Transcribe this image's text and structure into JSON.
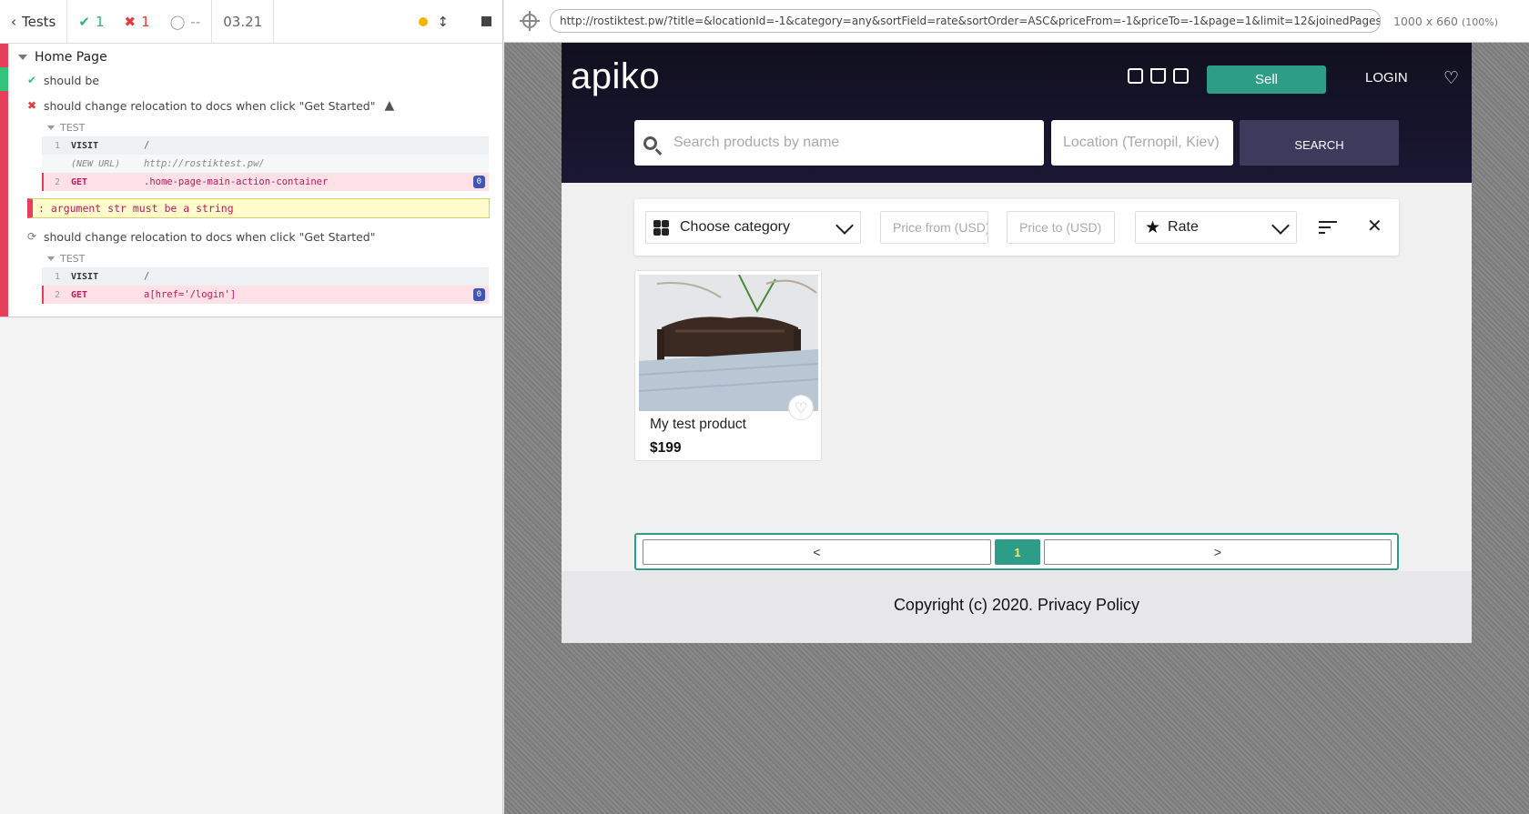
{
  "reporter": {
    "header": {
      "tests_label": "Tests",
      "passed": "1",
      "failed": "1",
      "pending": "--",
      "duration": "03.21"
    },
    "suite": {
      "title": "Home Page",
      "tests": [
        {
          "title": "should be",
          "state": "passed"
        },
        {
          "title": "should change relocation to docs when click \"Get Started\"",
          "state": "failed",
          "section_label": "TEST",
          "commands": [
            {
              "num": "1",
              "name": "VISIT",
              "message": "/"
            },
            {
              "num": "",
              "name": "(NEW URL)",
              "message": "http://rostiktest.pw/"
            },
            {
              "num": "2",
              "name": "GET",
              "message": ".home-page-main-action-container",
              "badge": "0"
            }
          ],
          "error": ": argument str must be a string"
        },
        {
          "title": "should change relocation to docs when click \"Get Started\"",
          "state": "running",
          "section_label": "TEST",
          "commands": [
            {
              "num": "1",
              "name": "VISIT",
              "message": "/"
            },
            {
              "num": "2",
              "name": "GET",
              "message": "a[href='/login']",
              "badge": "0"
            }
          ]
        }
      ]
    }
  },
  "runner": {
    "url": "http://rostiktest.pw/?title=&locationId=-1&category=any&sortField=rate&sortOrder=ASC&priceFrom=-1&priceTo=-1&page=1&limit=12&joinedPages",
    "viewport": "1000 x 660",
    "zoom": "(100%)"
  },
  "app": {
    "logo": "apiko",
    "sell_label": "Sell",
    "login_label": "LOGIN",
    "search": {
      "placeholder": "Search products by name",
      "location_placeholder": "Location (Ternopil, Kiev)",
      "button_label": "SEARCH"
    },
    "filters": {
      "category": "Choose category",
      "price_from_placeholder": "Price from (USD)",
      "price_to_placeholder": "Price to (USD)",
      "sort_field": "Rate"
    },
    "products": [
      {
        "title": "My test product",
        "price": "$199"
      }
    ],
    "pagination": {
      "prev": "<",
      "current": "1",
      "next": ">"
    },
    "footer": "Copyright (c) 2020. Privacy Policy"
  },
  "colors": {
    "accent": "#2d9d87",
    "fail": "#e53f5c",
    "pass": "#33c379",
    "header_dark": "#11101e"
  }
}
